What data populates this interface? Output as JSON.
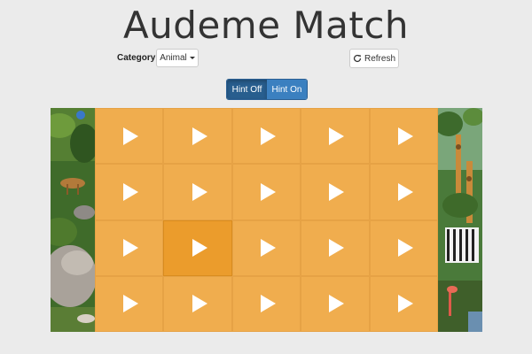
{
  "title": "Audeme Match",
  "controls": {
    "category_label": "Category:",
    "category_value": "Animal",
    "refresh_label": "Refresh",
    "hint_off_label": "Hint Off",
    "hint_on_label": "Hint On",
    "hint_state": "off"
  },
  "board": {
    "rows": 4,
    "columns": 5,
    "tile_icon": "play-icon",
    "highlighted_tile": {
      "row": 3,
      "column": 2
    },
    "side_art": "jungle-animals-illustration"
  },
  "colors": {
    "tile": "#f0ad4e",
    "tile_active": "#eb9c2c",
    "hint_off": "#285e8e",
    "hint_on": "#3b80c0"
  }
}
